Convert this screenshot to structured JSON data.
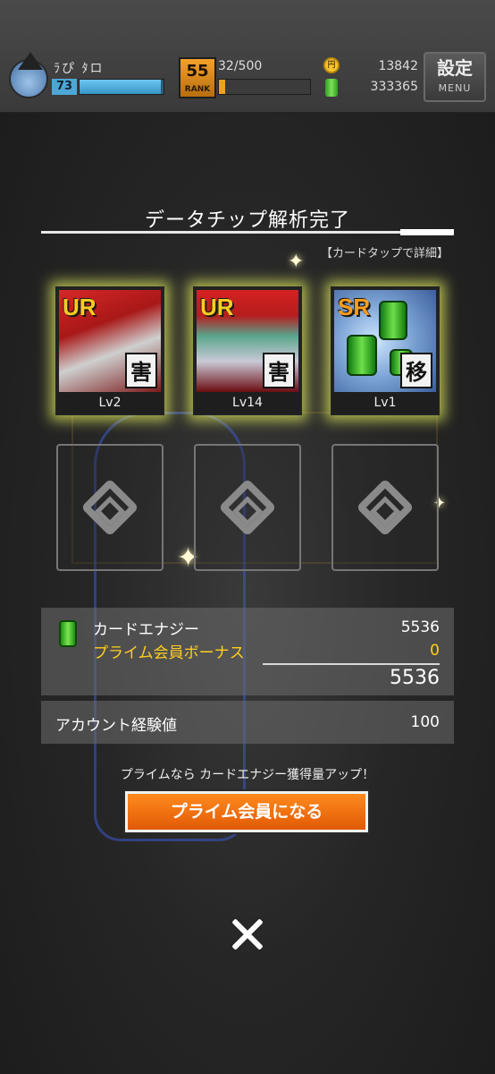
{
  "header": {
    "player_name": "ﾗぴ ﾀロ",
    "level": "73",
    "exp_fraction": 0.97,
    "rank_icon_number": "55",
    "rank_icon_label": "RANK",
    "rank_progress": "32/500",
    "rank_fraction": 0.064,
    "coins": "13842",
    "card_energy_total": "333365",
    "menu_kanji": "設定",
    "menu_label": "MENU"
  },
  "result": {
    "title": "データチップ解析完了",
    "detail_hint": "【カードタップで詳細】"
  },
  "cards": [
    {
      "rarity": "UR",
      "attribute": "害",
      "level": "Lv2"
    },
    {
      "rarity": "UR",
      "attribute": "害",
      "level": "Lv14"
    },
    {
      "rarity": "SR",
      "attribute": "移",
      "level": "Lv1"
    }
  ],
  "rewards": {
    "card_energy_label": "カードエナジー",
    "card_energy_value": "5536",
    "prime_bonus_label": "プライム会員ボーナス",
    "prime_bonus_value": "0",
    "energy_total": "5536",
    "account_exp_label": "アカウント経験値",
    "account_exp_value": "100"
  },
  "prime": {
    "note": "プライムなら カードエナジー獲得量アップ！",
    "button_label": "プライム会員になる"
  },
  "colors": {
    "accent_orange": "#e15a05",
    "bonus_yellow": "#ffcf1e",
    "energy_green": "#4fbf2f"
  },
  "icons": [
    "avatar",
    "rank-icon",
    "coin-icon",
    "card-energy-icon",
    "close-icon"
  ]
}
